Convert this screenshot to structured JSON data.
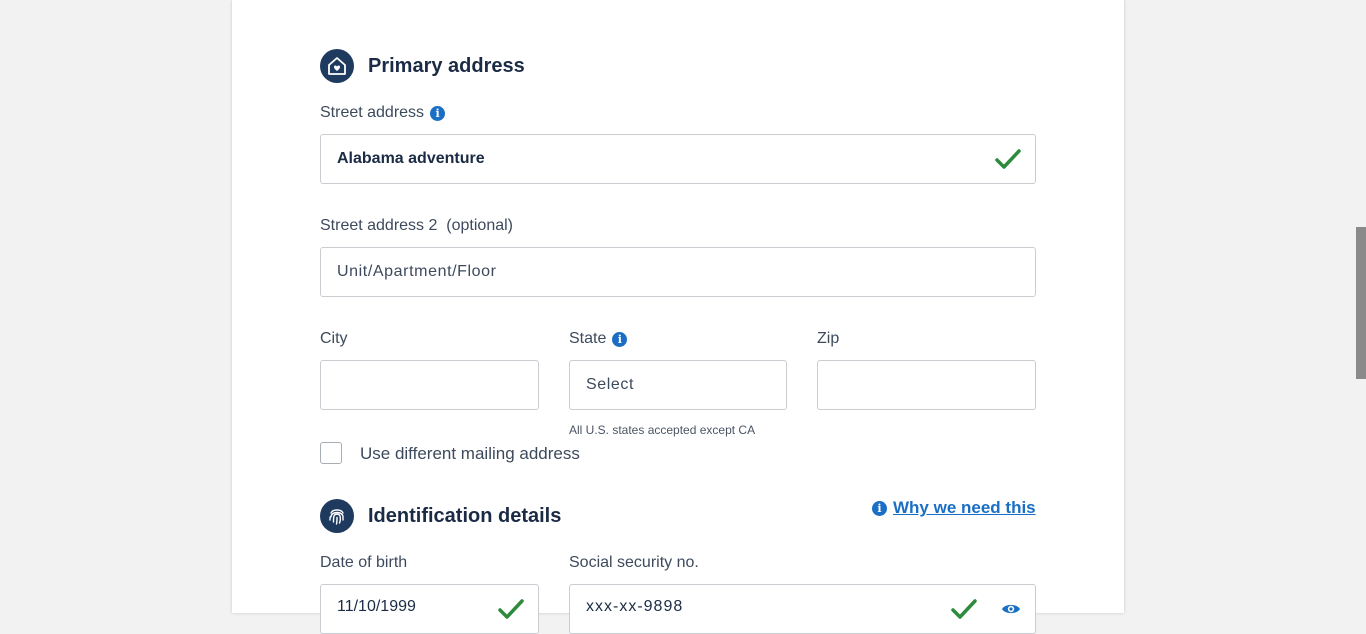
{
  "primary_address": {
    "title": "Primary address",
    "street": {
      "label": "Street address",
      "value": "Alabama adventure"
    },
    "street2": {
      "label": "Street address 2  (optional)",
      "placeholder": "Unit/Apartment/Floor"
    },
    "city": {
      "label": "City",
      "value": ""
    },
    "state": {
      "label": "State",
      "selected": "Select",
      "hint": "All U.S. states accepted except CA"
    },
    "zip": {
      "label": "Zip",
      "value": ""
    },
    "mailing_checkbox": {
      "label": "Use different mailing address",
      "checked": false
    }
  },
  "identification": {
    "title": "Identification details",
    "why_link": "Why we need this",
    "dob": {
      "label": "Date of birth",
      "value": "11/10/1999"
    },
    "ssn": {
      "label": "Social security no.",
      "value": "xxx-xx-9898"
    }
  },
  "colors": {
    "accent_blue": "#1a6fc4",
    "navy": "#1e3a5f",
    "valid_green": "#2e8b3e"
  }
}
